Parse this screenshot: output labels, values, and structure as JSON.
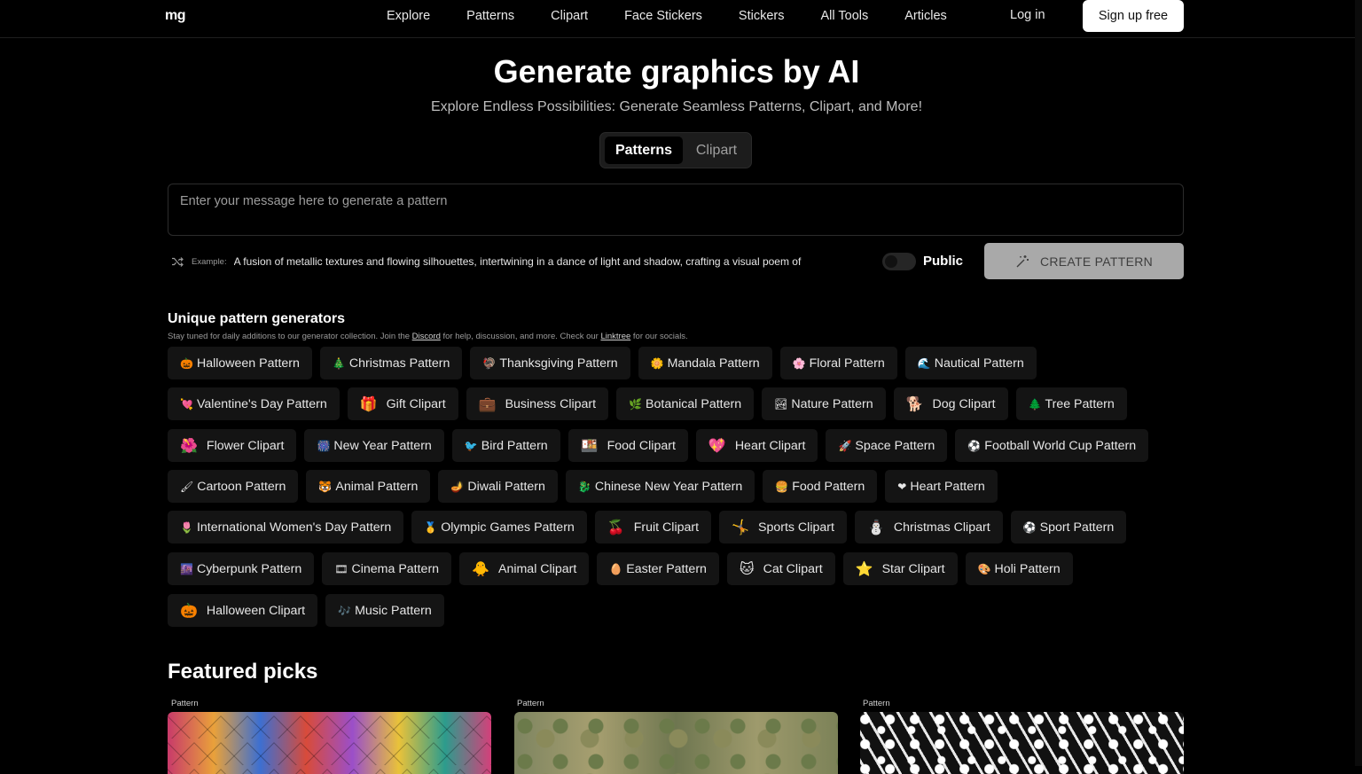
{
  "header": {
    "logo": "mg",
    "nav": [
      "Explore",
      "Patterns",
      "Clipart",
      "Face Stickers",
      "Stickers",
      "All Tools",
      "Articles"
    ],
    "login": "Log in",
    "signup": "Sign up free"
  },
  "hero": {
    "title": "Generate graphics by AI",
    "subtitle": "Explore Endless Possibilities: Generate Seamless Patterns, Clipart, and More!",
    "tabs": {
      "active": "Patterns",
      "inactive": "Clipart"
    }
  },
  "prompt": {
    "placeholder": "Enter your message here to generate a pattern",
    "example_label": "Example:",
    "example_text": "A fusion of metallic textures and flowing silhouettes, intertwining in a dance of light and shadow, crafting a visual poem of",
    "public_label": "Public",
    "public_on": false,
    "create_label": "CREATE PATTERN"
  },
  "generators": {
    "title": "Unique pattern generators",
    "sub_pre": "Stay tuned for daily additions to our generator collection. Join the ",
    "discord": "Discord",
    "sub_mid": " for help, discussion, and more. Check our ",
    "linktree": "Linktree",
    "sub_post": " for our socials.",
    "rows": [
      [
        {
          "e": "🎃",
          "t": "Halloween Pattern"
        },
        {
          "e": "🎄",
          "t": "Christmas Pattern"
        },
        {
          "e": "🦃",
          "t": "Thanksgiving Pattern"
        },
        {
          "e": "🌼",
          "t": "Mandala Pattern"
        },
        {
          "e": "🌸",
          "t": "Floral Pattern"
        },
        {
          "e": "🌊",
          "t": "Nautical Pattern"
        }
      ],
      [
        {
          "e": "💘",
          "t": "Valentine's Day Pattern"
        },
        {
          "e": "🎁",
          "t": "Gift Clipart",
          "big": true
        },
        {
          "e": "💼",
          "t": "Business Clipart",
          "big": true
        },
        {
          "e": "🌿",
          "t": "Botanical Pattern"
        },
        {
          "e": "🏞",
          "t": "Nature Pattern"
        },
        {
          "e": "🐕",
          "t": "Dog Clipart",
          "big": true
        },
        {
          "e": "🌲",
          "t": "Tree Pattern"
        }
      ],
      [
        {
          "e": "🌺",
          "t": "Flower Clipart",
          "big": true
        },
        {
          "e": "🎆",
          "t": "New Year Pattern"
        },
        {
          "e": "🐦",
          "t": "Bird Pattern"
        },
        {
          "e": "🍱",
          "t": "Food Clipart",
          "big": true
        },
        {
          "e": "💖",
          "t": "Heart Clipart",
          "big": true
        },
        {
          "e": "🚀",
          "t": "Space Pattern"
        },
        {
          "e": "⚽",
          "t": "Football World Cup Pattern"
        }
      ],
      [
        {
          "e": "🖌",
          "t": "Cartoon Pattern"
        },
        {
          "e": "🐯",
          "t": "Animal Pattern"
        },
        {
          "e": "🪔",
          "t": "Diwali Pattern"
        },
        {
          "e": "🐉",
          "t": "Chinese New Year Pattern"
        },
        {
          "e": "🍔",
          "t": "Food Pattern"
        },
        {
          "e": "❤",
          "t": "Heart Pattern"
        }
      ],
      [
        {
          "e": "🌷",
          "t": "International Women's Day Pattern"
        },
        {
          "e": "🥇",
          "t": "Olympic Games Pattern"
        },
        {
          "e": "🍒",
          "t": "Fruit Clipart",
          "big": true
        },
        {
          "e": "🤸",
          "t": "Sports Clipart",
          "big": true
        },
        {
          "e": "⛄",
          "t": "Christmas Clipart",
          "big": true
        },
        {
          "e": "⚽",
          "t": "Sport Pattern"
        }
      ],
      [
        {
          "e": "🌆",
          "t": "Cyberpunk Pattern"
        },
        {
          "e": "🎞",
          "t": "Cinema Pattern"
        },
        {
          "e": "🐥",
          "t": "Animal Clipart",
          "big": true
        },
        {
          "e": "🥚",
          "t": "Easter Pattern"
        },
        {
          "e": "🐱",
          "t": "Cat Clipart",
          "big": true
        },
        {
          "e": "⭐",
          "t": "Star Clipart",
          "big": true
        },
        {
          "e": "🎨",
          "t": "Holi Pattern"
        }
      ],
      [
        {
          "e": "🎃",
          "t": "Halloween Clipart",
          "big": true
        },
        {
          "e": "🎶",
          "t": "Music Pattern"
        }
      ]
    ]
  },
  "featured": {
    "title": "Featured picks",
    "cards": [
      {
        "label": "Pattern"
      },
      {
        "label": "Pattern"
      },
      {
        "label": "Pattern"
      }
    ]
  }
}
